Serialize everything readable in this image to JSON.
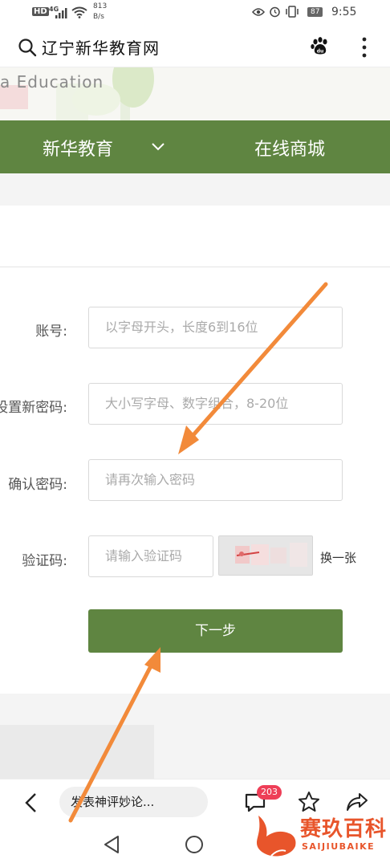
{
  "status_bar": {
    "hd": "HD",
    "network": "4G",
    "speed_value": "813",
    "speed_unit": "B/s",
    "battery": "87",
    "time": "9:55"
  },
  "browser": {
    "site_title": "辽宁新华教育网"
  },
  "banner": {
    "text": "a Education"
  },
  "nav": {
    "items": [
      "新华教育",
      "在线商城"
    ]
  },
  "form": {
    "account_label": "账号:",
    "account_placeholder": "以字母开头，长度6到16位",
    "new_password_label": "设置新密码:",
    "new_password_placeholder": "大小写字母、数字组合，8-20位",
    "confirm_password_label": "确认密码:",
    "confirm_password_placeholder": "请再次输入密码",
    "captcha_label": "验证码:",
    "captcha_placeholder": "请输入验证码",
    "refresh_captcha": "换一张",
    "next_button": "下一步"
  },
  "toolbar": {
    "comment_placeholder": "发表神评妙论...",
    "comment_count": "203"
  },
  "watermark": {
    "text": "赛玖百科",
    "sub": "SAIJIUBAIKE"
  },
  "colors": {
    "brand_green": "#5f8541",
    "badge_red": "#ee3e57",
    "arrow_orange": "#f28a3a"
  },
  "icons": [
    "search-icon",
    "baidu-paw-icon",
    "more-vertical-icon",
    "chevron-down-icon",
    "back-icon",
    "comment-icon",
    "star-icon",
    "share-icon",
    "nav-back-icon",
    "nav-home-icon"
  ]
}
